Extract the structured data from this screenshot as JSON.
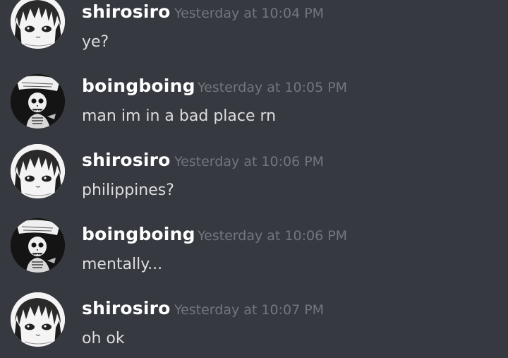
{
  "messages": [
    {
      "author": "shirosiro",
      "timestamp": "Yesterday at 10:04 PM",
      "text": "ye?",
      "avatar": "anime-girl-avatar-icon"
    },
    {
      "author": "boingboing",
      "timestamp": "Yesterday at 10:05 PM",
      "text": "man im in a bad place rn",
      "avatar": "skeleton-avatar-icon"
    },
    {
      "author": "shirosiro",
      "timestamp": "Yesterday at 10:06 PM",
      "text": "philippines?",
      "avatar": "anime-girl-avatar-icon"
    },
    {
      "author": "boingboing",
      "timestamp": "Yesterday at 10:06 PM",
      "text": "mentally...",
      "avatar": "skeleton-avatar-icon"
    },
    {
      "author": "shirosiro",
      "timestamp": "Yesterday at 10:07 PM",
      "text": "oh ok",
      "avatar": "anime-girl-avatar-icon"
    }
  ],
  "colors": {
    "background": "#36393f",
    "username": "#ffffff",
    "timestamp": "#72767d",
    "message_text": "#dcddde"
  }
}
